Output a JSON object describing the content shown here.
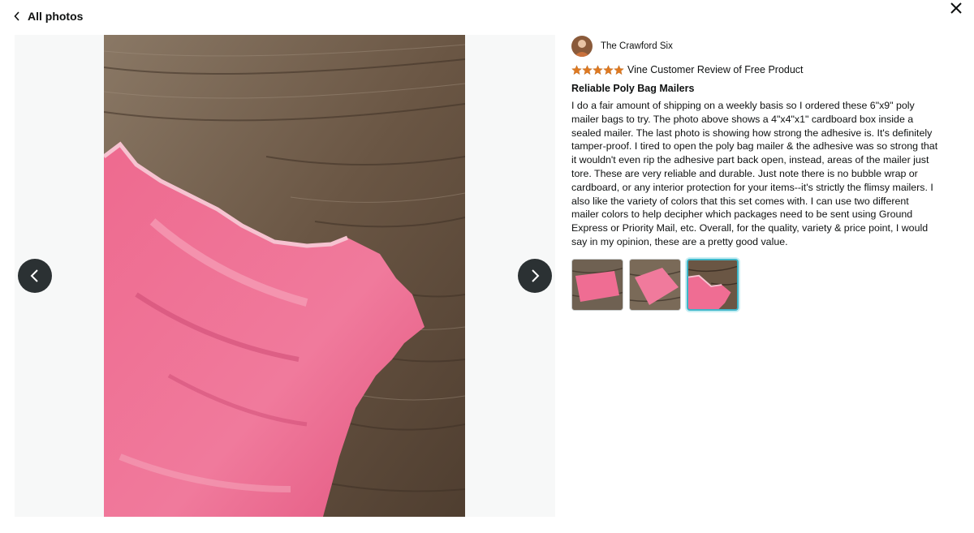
{
  "header": {
    "back_label": "All photos"
  },
  "review": {
    "reviewer_name": "The Crawford Six",
    "rating": 5,
    "badge": "Vine Customer Review of Free Product",
    "title": "Reliable Poly Bag Mailers",
    "body": "I do a fair amount of shipping on a weekly basis so I ordered these 6\"x9\" poly mailer bags to try. The photo above shows a 4\"x4\"x1\" cardboard box inside a sealed mailer. The last photo is showing how strong the adhesive is. It's definitely tamper-proof. I tired to open the poly bag mailer & the adhesive was so strong that it wouldn't even rip the adhesive part back open, instead, areas of the mailer just tore. These are very reliable and durable. Just note there is no bubble wrap or cardboard, or any interior protection for your items--it's strictly the flimsy mailers. I also like the variety of colors that this set comes with. I can use two different mailer colors to help decipher which packages need to be sent using Ground Express or Priority Mail, etc. Overall, for the quality, variety & price point, I would say in my opinion, these are a pretty good value."
  },
  "thumbnails": {
    "count": 3,
    "selected_index": 2
  },
  "colors": {
    "star": "#de7921",
    "nav_button": "#2b3133",
    "selected_thumb_border": "#3fb6c9",
    "mailer_pink": "#ef6d93",
    "wood": "#6f5a46"
  },
  "icons": {
    "back": "chevron-left-icon",
    "close": "close-icon",
    "prev": "chevron-left-icon",
    "next": "chevron-right-icon",
    "star": "star-icon"
  }
}
